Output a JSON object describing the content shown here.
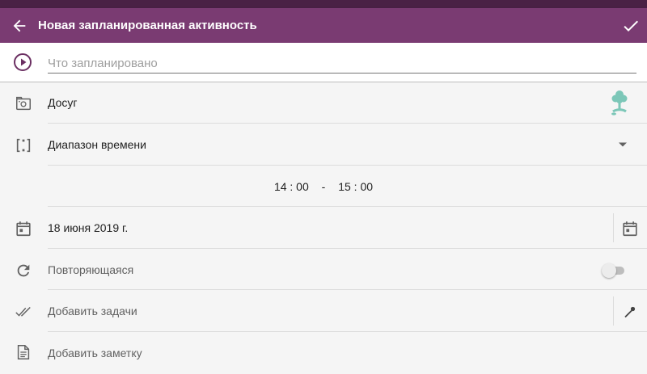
{
  "appbar": {
    "title": "Новая запланированная активность",
    "back_icon": "arrow-back-icon",
    "done_icon": "check-icon"
  },
  "name_field": {
    "placeholder": "Что запланировано",
    "value": "",
    "icon": "play-circle-icon"
  },
  "category": {
    "label": "Досуг",
    "icon": "category-image-icon",
    "activity_icon": "tree-icon",
    "activity_icon_color": "#7cc7b8"
  },
  "time_mode": {
    "label": "Диапазон времени",
    "icon": "time-range-icon",
    "dropdown_icon": "dropdown-arrow-icon"
  },
  "time_range": {
    "start": "14 : 00",
    "separator": "-",
    "end": "15 : 00"
  },
  "date": {
    "label": "18 июня 2019 г.",
    "icon": "calendar-icon",
    "picker_icon": "calendar-icon"
  },
  "repeat": {
    "label": "Повторяющаяся",
    "icon": "repeat-icon",
    "enabled": false
  },
  "tasks": {
    "label": "Добавить задачи",
    "icon": "double-check-icon",
    "action_icon": "mic-icon"
  },
  "note": {
    "label": "Добавить заметку",
    "icon": "note-icon"
  },
  "colors": {
    "statusbar": "#4a2145",
    "primary": "#7a3b72",
    "background": "#f5f5f5"
  }
}
